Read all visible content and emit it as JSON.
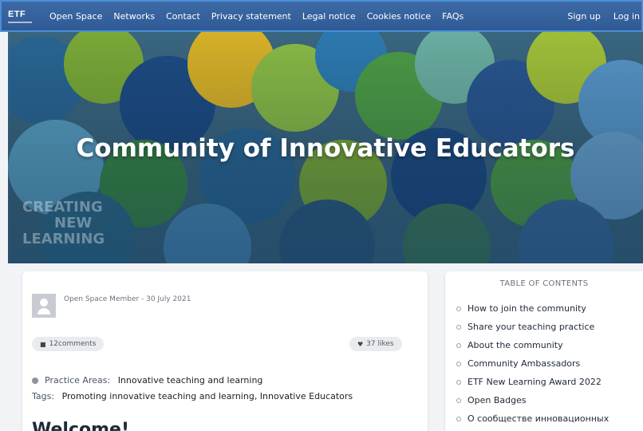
{
  "nav": {
    "logo": "ETF",
    "links": [
      "Open Space",
      "Networks",
      "Contact",
      "Privacy statement",
      "Legal notice",
      "Cookies notice",
      "FAQs"
    ],
    "signup": "Sign up",
    "login": "Log in"
  },
  "hero": {
    "title": "Community of Innovative Educators",
    "overlay_lines": [
      "CREATING",
      "NEW",
      "LEARNING"
    ]
  },
  "post": {
    "author_meta": "Open Space Member - 30 July 2021",
    "comments": "12comments",
    "likes": "37 likes",
    "practice_label": "Practice Areas:",
    "practice_value": "Innovative teaching and learning",
    "tags_label": "Tags:",
    "tags_value": "Promoting innovative teaching and learning,  Innovative Educators",
    "heading": "Welcome!"
  },
  "toc": {
    "title": "TABLE OF CONTENTS",
    "items": [
      "How to join the community",
      "Share your teaching practice",
      "About the community",
      "Community Ambassadors",
      "ETF New Learning Award 2022",
      "Open Badges",
      "О сообществе инновационных"
    ]
  }
}
